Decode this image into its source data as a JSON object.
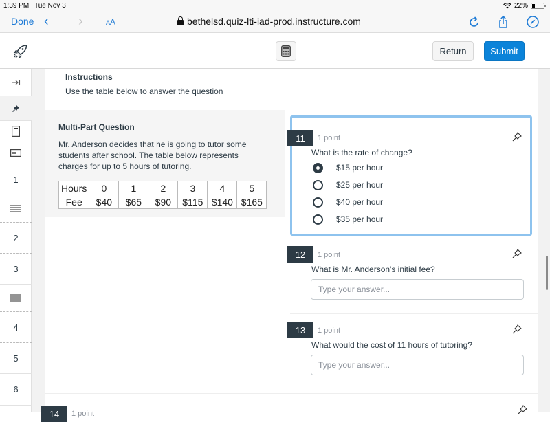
{
  "status_bar": {
    "time": "1:39 PM",
    "date": "Tue Nov 3",
    "battery": "22%"
  },
  "browser": {
    "done_label": "Done",
    "text_size_label": "AA",
    "url": "bethelsd.quiz-lti-iad-prod.instructure.com",
    "icons": [
      "back-chevron-icon",
      "forward-chevron-icon",
      "lock-icon",
      "reload-icon",
      "share-icon",
      "compass-icon"
    ]
  },
  "app_header": {
    "logo_icon": "rocket-icon",
    "calculator_icon": "calculator-icon",
    "return_label": "Return",
    "submit_label": "Submit",
    "submit_color": "#0b83d9"
  },
  "sidebar": {
    "items": [
      {
        "type": "icon",
        "icon": "collapse-arrow-icon"
      },
      {
        "type": "icon",
        "icon": "pin-icon"
      },
      {
        "type": "icon",
        "icon": "instructions-icon"
      },
      {
        "type": "icon",
        "icon": "stimulus-icon"
      },
      {
        "type": "number",
        "label": "1"
      },
      {
        "type": "icon",
        "icon": "text-block-icon"
      },
      {
        "type": "number",
        "label": "2"
      },
      {
        "type": "number",
        "label": "3"
      },
      {
        "type": "icon",
        "icon": "text-block-icon"
      },
      {
        "type": "number",
        "label": "4"
      },
      {
        "type": "number",
        "label": "5"
      },
      {
        "type": "number",
        "label": "6"
      }
    ]
  },
  "instructions": {
    "title": "Instructions",
    "text": "Use the table below to answer the question"
  },
  "stimulus": {
    "title": "Multi-Part Question",
    "text": "Mr. Anderson decides that he is going to tutor some students after school. The table below represents charges for up to 5 hours of tutoring.",
    "table": {
      "rows": [
        [
          "Hours",
          "0",
          "1",
          "2",
          "3",
          "4",
          "5"
        ],
        [
          "Fee",
          "$40",
          "$65",
          "$90",
          "$115",
          "$140",
          "$165"
        ]
      ]
    }
  },
  "questions": [
    {
      "number": "11",
      "points": "1 point",
      "text": "What is the rate of change?",
      "type": "multiple-choice",
      "options": [
        "$15 per hour",
        "$25 per hour",
        "$40 per hour",
        "$35 per hour"
      ],
      "selected_index": 0
    },
    {
      "number": "12",
      "points": "1 point",
      "text": "What is Mr. Anderson's initial fee?",
      "type": "short-answer",
      "value": "",
      "placeholder": "Type your answer..."
    },
    {
      "number": "13",
      "points": "1 point",
      "text": "What would the cost of 11 hours of tutoring?",
      "type": "short-answer",
      "value": "",
      "placeholder": "Type your answer..."
    },
    {
      "number": "14",
      "points": "1 point"
    }
  ]
}
